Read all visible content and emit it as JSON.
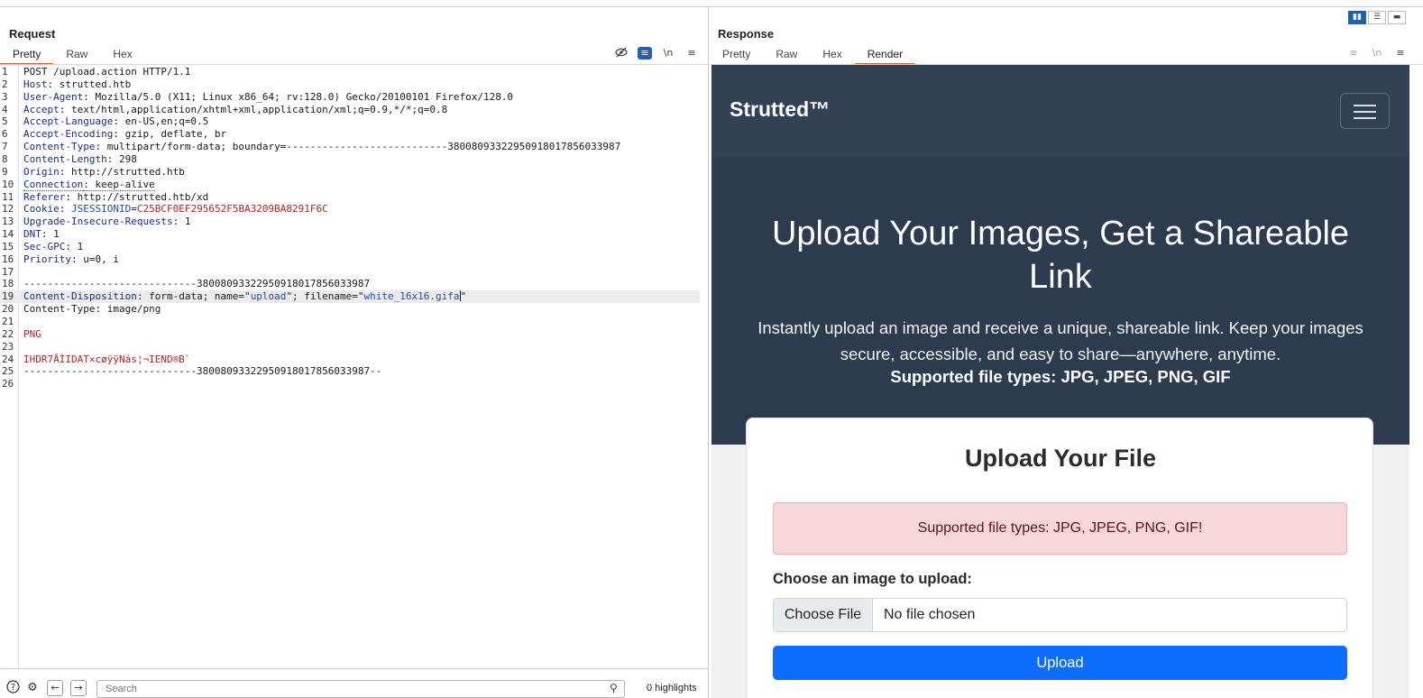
{
  "request": {
    "title": "Request",
    "tabs": [
      "Pretty",
      "Raw",
      "Hex"
    ],
    "lines": [
      {
        "n": "1",
        "segs": [
          {
            "t": "POST /upload.action HTTP/1.1",
            "c": ""
          }
        ]
      },
      {
        "n": "2",
        "segs": [
          {
            "t": "Host",
            "c": "hk"
          },
          {
            "t": ": strutted.htb",
            "c": ""
          }
        ]
      },
      {
        "n": "3",
        "segs": [
          {
            "t": "User-Agent",
            "c": "hk"
          },
          {
            "t": ": Mozilla/5.0 (X11; Linux x86_64; rv:128.0) Gecko/20100101 Firefox/128.0",
            "c": ""
          }
        ]
      },
      {
        "n": "4",
        "segs": [
          {
            "t": "Accept",
            "c": "hk"
          },
          {
            "t": ": text/html,application/xhtml+xml,application/xml;q=0.9,*/*;q=0.8",
            "c": ""
          }
        ]
      },
      {
        "n": "5",
        "segs": [
          {
            "t": "Accept-Language",
            "c": "hk"
          },
          {
            "t": ": en-US,en;q=0.5",
            "c": ""
          }
        ]
      },
      {
        "n": "6",
        "segs": [
          {
            "t": "Accept-Encoding",
            "c": "hk"
          },
          {
            "t": ": gzip, deflate, br",
            "c": ""
          }
        ]
      },
      {
        "n": "7",
        "segs": [
          {
            "t": "Content-Type",
            "c": "hk"
          },
          {
            "t": ": multipart/form-data; boundary=---------------------------38008093322950918017856033987",
            "c": ""
          }
        ]
      },
      {
        "n": "8",
        "segs": [
          {
            "t": "Content-Length",
            "c": "hk"
          },
          {
            "t": ": 298",
            "c": ""
          }
        ]
      },
      {
        "n": "9",
        "segs": [
          {
            "t": "Origin",
            "c": "hk"
          },
          {
            "t": ": http://strutted.htb",
            "c": ""
          }
        ]
      },
      {
        "n": "10",
        "segs": [
          {
            "t": "Connection",
            "c": "hk dotted"
          },
          {
            "t": ": keep-alive",
            "c": "dotted"
          }
        ]
      },
      {
        "n": "11",
        "segs": [
          {
            "t": "Referer",
            "c": "hk"
          },
          {
            "t": ": http://strutted.htb/xd",
            "c": ""
          }
        ]
      },
      {
        "n": "12",
        "segs": [
          {
            "t": "Cookie",
            "c": "hk"
          },
          {
            "t": ": ",
            "c": ""
          },
          {
            "t": "JSESSIONID",
            "c": "blue"
          },
          {
            "t": "=",
            "c": ""
          },
          {
            "t": "C25BCF0EF295652F5BA3209BA8291F6C",
            "c": "red"
          }
        ]
      },
      {
        "n": "13",
        "segs": [
          {
            "t": "Upgrade-Insecure-Requests",
            "c": "hk"
          },
          {
            "t": ": 1",
            "c": ""
          }
        ]
      },
      {
        "n": "14",
        "segs": [
          {
            "t": "DNT",
            "c": "hk"
          },
          {
            "t": ": 1",
            "c": ""
          }
        ]
      },
      {
        "n": "15",
        "segs": [
          {
            "t": "Sec-GPC",
            "c": "hk"
          },
          {
            "t": ": 1",
            "c": ""
          }
        ]
      },
      {
        "n": "16",
        "segs": [
          {
            "t": "Priority",
            "c": "hk"
          },
          {
            "t": ": u=0, i",
            "c": ""
          }
        ]
      },
      {
        "n": "17",
        "segs": []
      },
      {
        "n": "18",
        "segs": [
          {
            "t": "-----------------------------38008093322950918017856033987",
            "c": ""
          }
        ]
      },
      {
        "n": "19",
        "hl": true,
        "segs": [
          {
            "t": "Content-Disposition",
            "c": "hk"
          },
          {
            "t": ": form-data; name=\"",
            "c": ""
          },
          {
            "t": "upload",
            "c": "blue"
          },
          {
            "t": "\"; filename=\"",
            "c": ""
          },
          {
            "t": "white_16x16.gifa",
            "c": "blue"
          },
          {
            "t": "|caret|",
            "c": "caret"
          },
          {
            "t": "\"",
            "c": ""
          }
        ]
      },
      {
        "n": "20",
        "segs": [
          {
            "t": "Content-Type: image/png",
            "c": ""
          }
        ]
      },
      {
        "n": "21",
        "segs": []
      },
      {
        "n": "22",
        "segs": [
          {
            "t": "PNG",
            "c": "red"
          }
        ]
      },
      {
        "n": "23",
        "segs": []
      },
      {
        "n": "24",
        "segs": [
          {
            "t": "IHDR7ÂÌIDAT×cøÿÿNás¦¬IEND®B`",
            "c": "red"
          }
        ]
      },
      {
        "n": "25",
        "segs": [
          {
            "t": "-----------------------------38008093322950918017856033987--",
            "c": ""
          }
        ]
      },
      {
        "n": "26",
        "segs": []
      }
    ],
    "search_placeholder": "Search",
    "highlights": "0 highlights"
  },
  "response": {
    "title": "Response",
    "tabs": [
      "Pretty",
      "Raw",
      "Hex",
      "Render"
    ],
    "render": {
      "brand": "Strutted™",
      "hero_title": "Upload Your Images, Get a Shareable Link",
      "hero_sub": "Instantly upload an image and receive a unique, shareable link. Keep your images secure, accessible, and easy to share—anywhere, anytime.",
      "hero_strong": "Supported file types: JPG, JPEG, PNG, GIF",
      "card_title": "Upload Your File",
      "alert": "Supported file types: JPG, JPEG, PNG, GIF!",
      "choose_label": "Choose an image to upload:",
      "choose_button": "Choose File",
      "no_file": "No file chosen",
      "upload_button": "Upload"
    }
  },
  "colors": {
    "accent_tab": "#e8602c",
    "header_key": "#1b2d8a",
    "value_red": "#b3261e",
    "nav_bg": "#334155",
    "hero_bg": "#2d3b4e",
    "upload_btn": "#0d6efd",
    "alert_bg": "#f8d7da"
  },
  "icons": {
    "hide": "eye-slash-icon",
    "wrap": "wrap-icon",
    "newline": "newline-icon",
    "menu": "hamburger-icon",
    "help": "help-icon",
    "settings": "gear-icon",
    "back": "arrow-left-icon",
    "forward": "arrow-right-icon",
    "search": "search-icon"
  }
}
